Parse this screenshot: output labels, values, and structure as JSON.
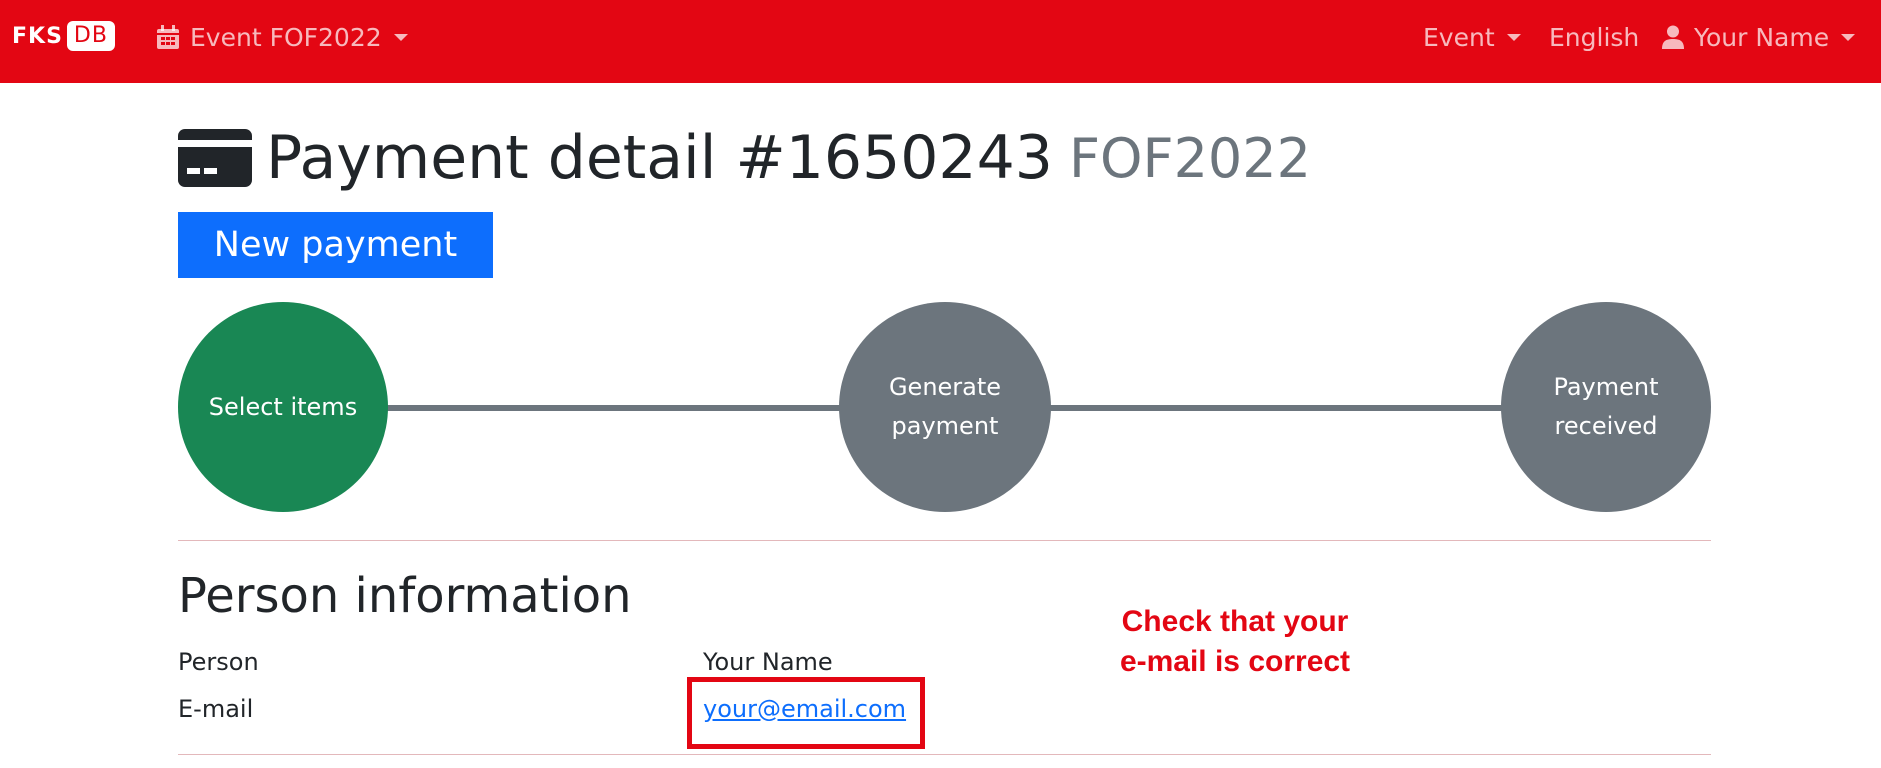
{
  "navbar": {
    "logo_text": "FKS",
    "logo_box_text": "DB",
    "event_selector": "Event FOF2022",
    "event_menu": "Event",
    "language": "English",
    "user_menu": "Your Name",
    "background_color": "#e30613"
  },
  "page": {
    "title": "Payment detail #1650243",
    "subtitle": "FOF2022",
    "new_payment_label": "New payment"
  },
  "steps": [
    {
      "label": "Select items",
      "status": "done",
      "color": "#198754"
    },
    {
      "label": "Generate payment",
      "status": "pending",
      "color": "#6c757d"
    },
    {
      "label": "Payment received",
      "status": "pending",
      "color": "#6c757d"
    }
  ],
  "person_info": {
    "heading": "Person information",
    "person_label": "Person",
    "person_value": "Your Name",
    "email_label": "E-mail",
    "email_value": "your@email.com"
  },
  "annotation": {
    "line1": "Check that your",
    "line2": "e-mail is correct",
    "color": "#e30613"
  },
  "icons": {
    "event": "calendar-icon",
    "user": "user-icon",
    "title": "credit-card-icon"
  }
}
